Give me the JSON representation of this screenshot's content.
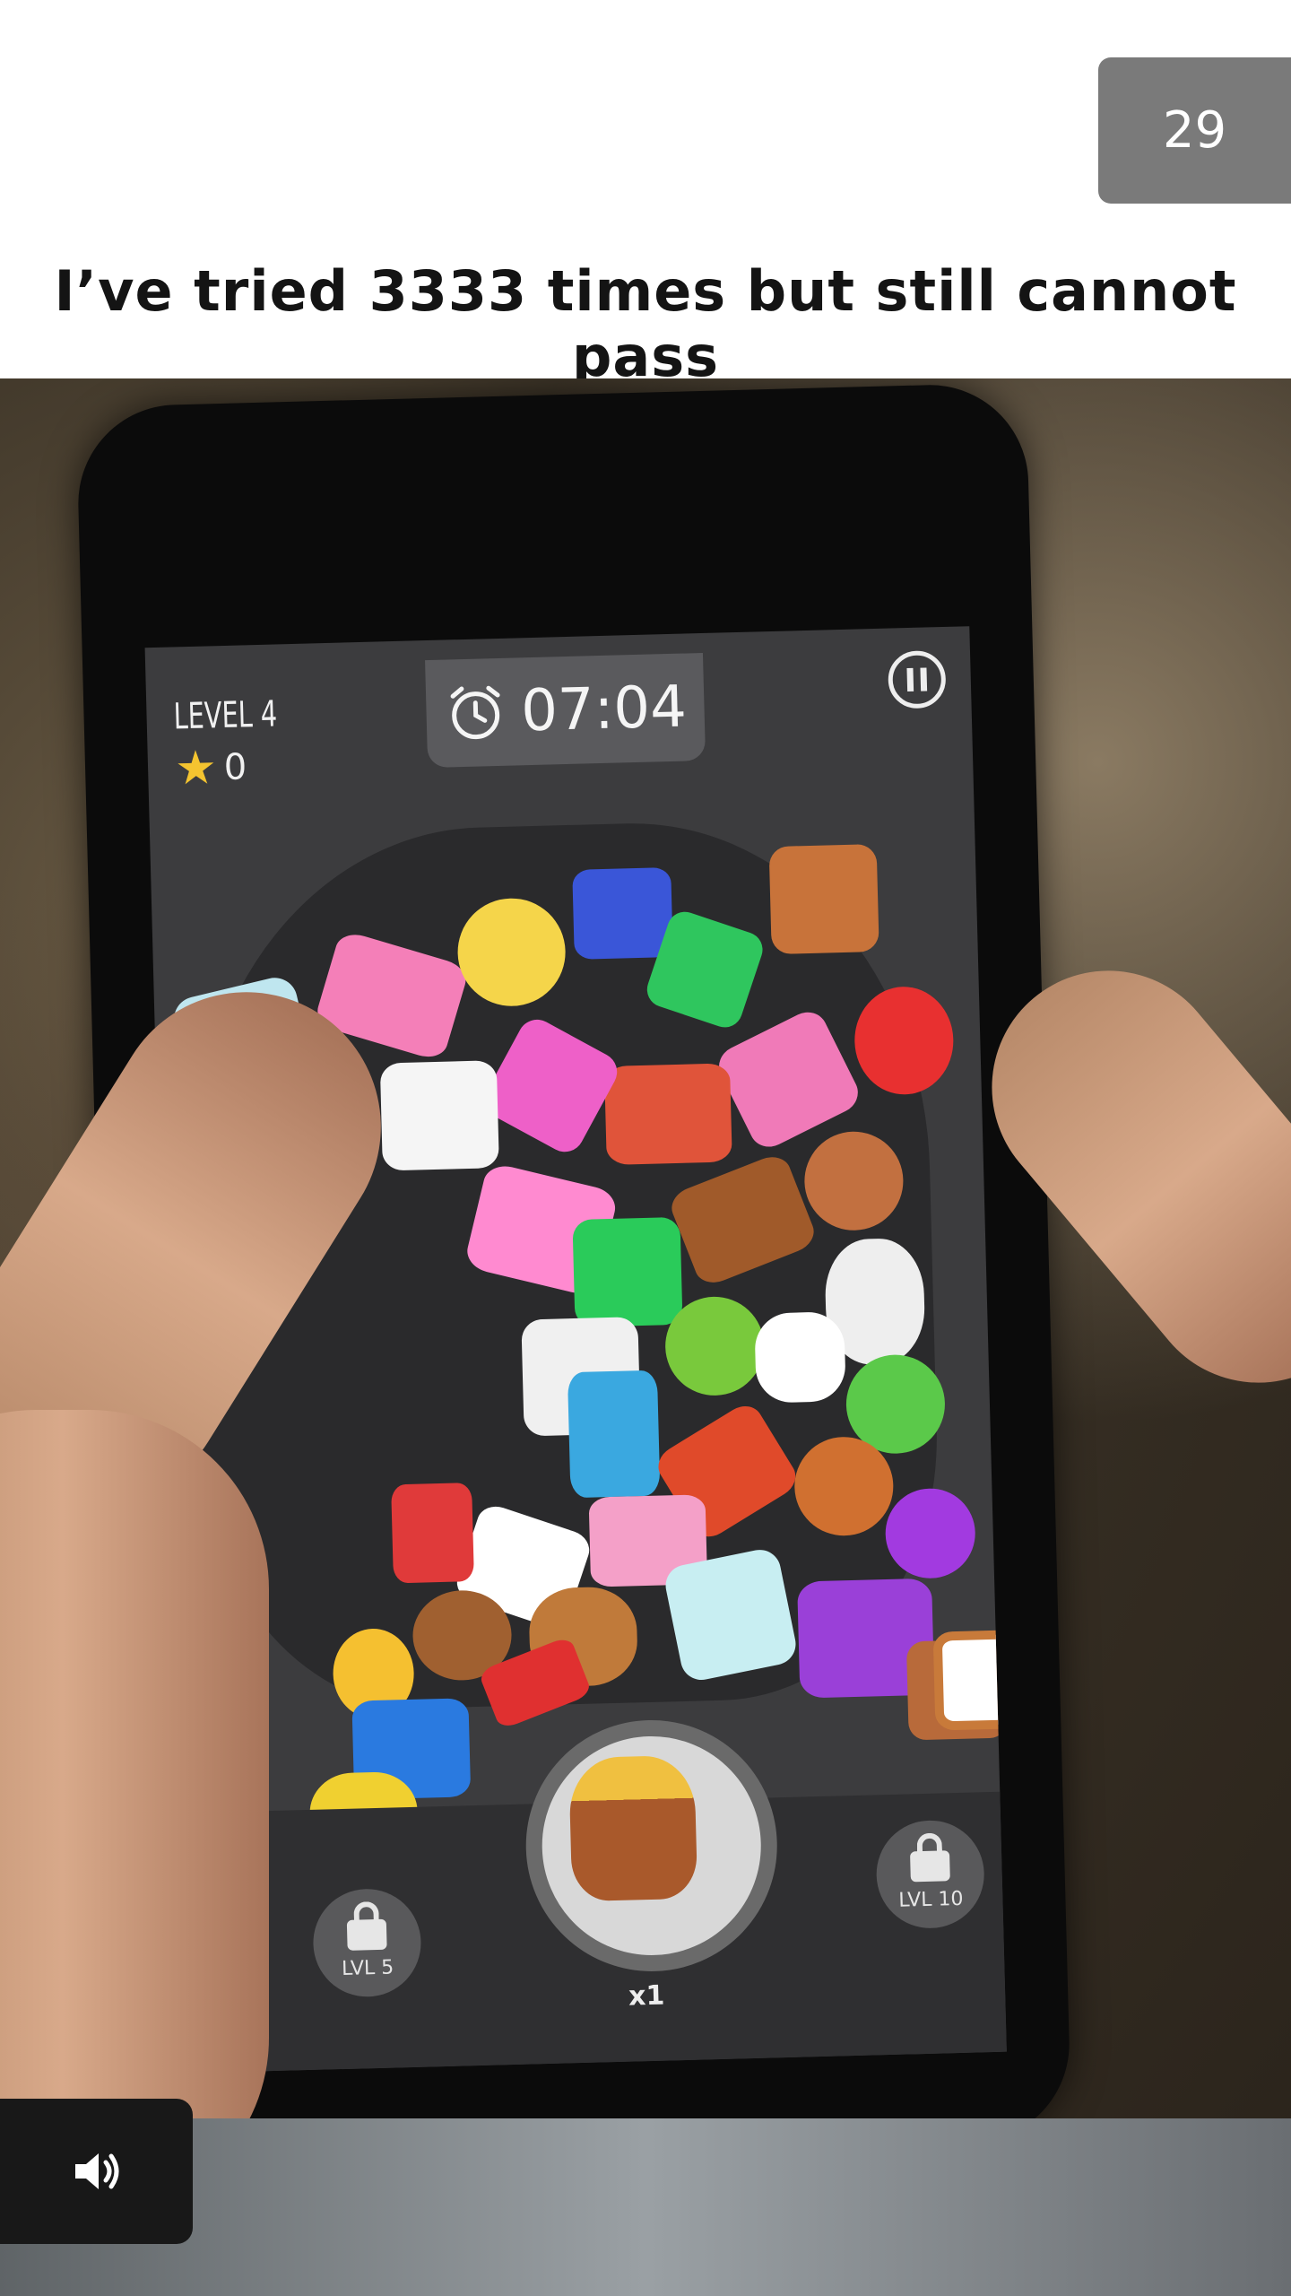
{
  "counter": {
    "value": "29"
  },
  "caption": {
    "text": "I’ve tried 3333 times but still cannot pass"
  },
  "game": {
    "level_label": "LEVEL 4",
    "stars": "0",
    "timer": "07:04",
    "slot_multiplier": "x1",
    "locked_slots": [
      {
        "label": "LVL 5"
      },
      {
        "label": "LVL 10"
      }
    ]
  },
  "icons": {
    "timer": "alarm-clock-icon",
    "pause": "pause-icon",
    "star": "star-icon",
    "lock": "lock-icon",
    "sound": "speaker-icon"
  },
  "colors": {
    "counter_bg": "#7a7a7a",
    "game_bg": "#3c3c3e",
    "star": "#f4c430"
  }
}
